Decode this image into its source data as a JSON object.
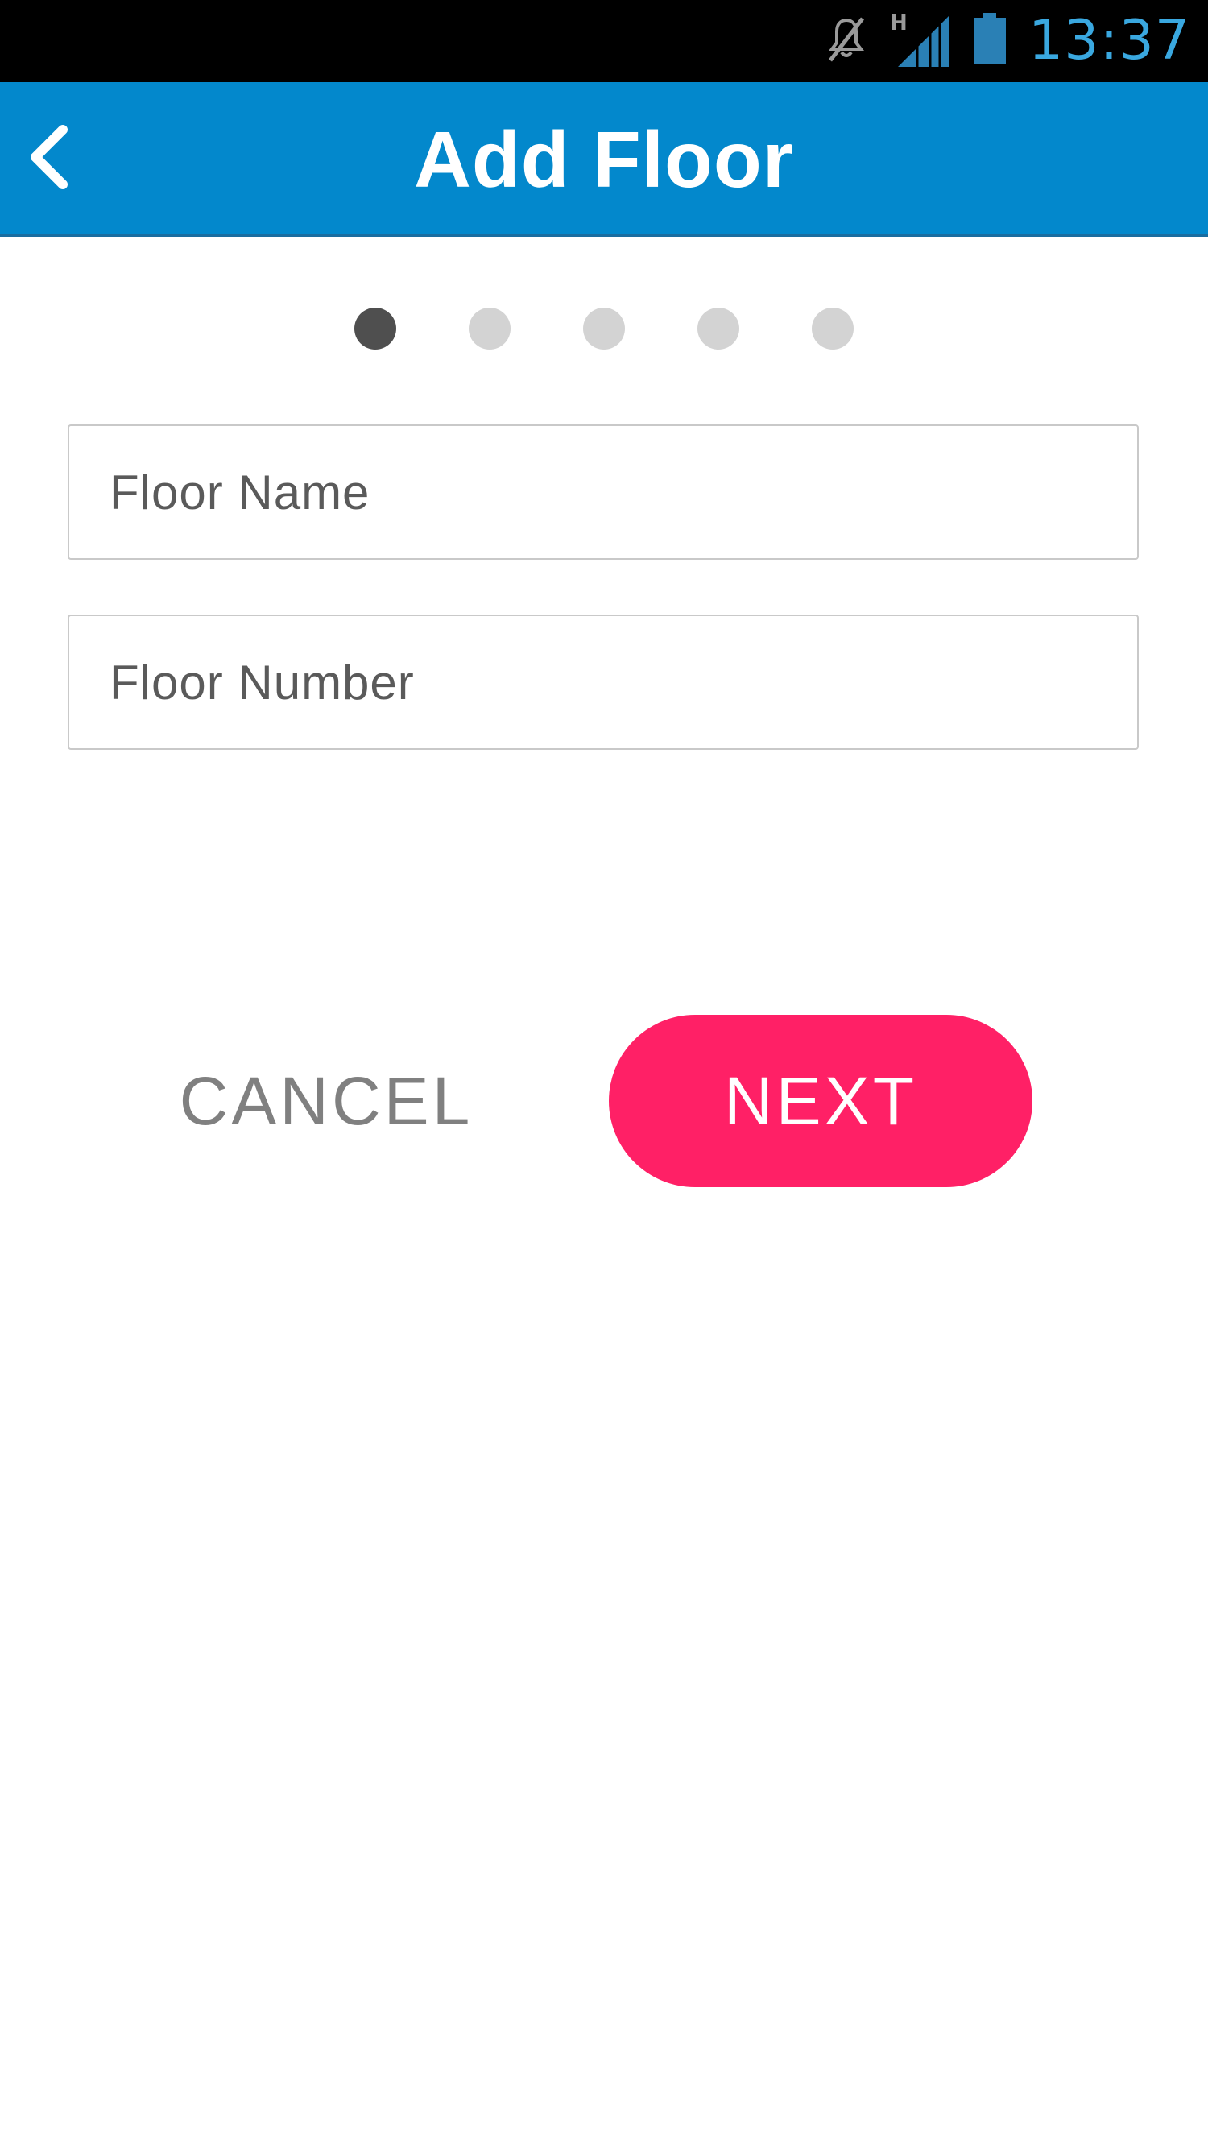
{
  "status_bar": {
    "time": "13:37",
    "icons": [
      "mute-icon",
      "signal-h-icon",
      "battery-icon"
    ],
    "time_color": "#3aa8e0"
  },
  "app_bar": {
    "title": "Add Floor",
    "back_icon": "chevron-left-icon",
    "background": "#0388cc"
  },
  "pager": {
    "total_steps": 5,
    "current_step": 1
  },
  "form": {
    "floor_name": {
      "placeholder": "Floor Name",
      "value": ""
    },
    "floor_number": {
      "placeholder": "Floor Number",
      "value": ""
    }
  },
  "actions": {
    "cancel_label": "CANCEL",
    "next_label": "NEXT",
    "next_color": "#ff2066"
  }
}
